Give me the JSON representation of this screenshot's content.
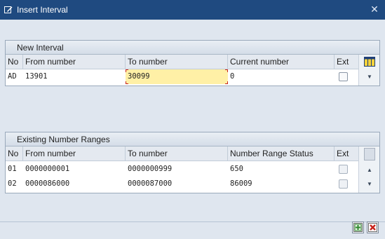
{
  "window": {
    "title": "Insert Interval",
    "icon": "window-edit-icon"
  },
  "new_interval": {
    "title": "New Interval",
    "columns": [
      "No",
      "From number",
      "To number",
      "Current number",
      "Ext"
    ],
    "row": {
      "no": "AD",
      "from": "13901",
      "to": "30099",
      "current": "0",
      "ext": false
    }
  },
  "existing": {
    "title": "Existing Number Ranges",
    "columns": [
      "No",
      "From number",
      "To number",
      "Number Range Status",
      "Ext"
    ],
    "rows": [
      {
        "no": "01",
        "from": "0000000001",
        "to": "0000000999",
        "status": "650",
        "ext": false
      },
      {
        "no": "02",
        "from": "0000086000",
        "to": "0000087000",
        "status": "86009",
        "ext": false
      }
    ]
  },
  "buttons": {
    "confirm": "confirm-icon",
    "cancel": "cancel-icon"
  },
  "colors": {
    "titlebar": "#1f4a80",
    "highlight_field": "#fff0a6",
    "cancel_red": "#c8231b",
    "confirm_green": "#2f8a2f"
  }
}
